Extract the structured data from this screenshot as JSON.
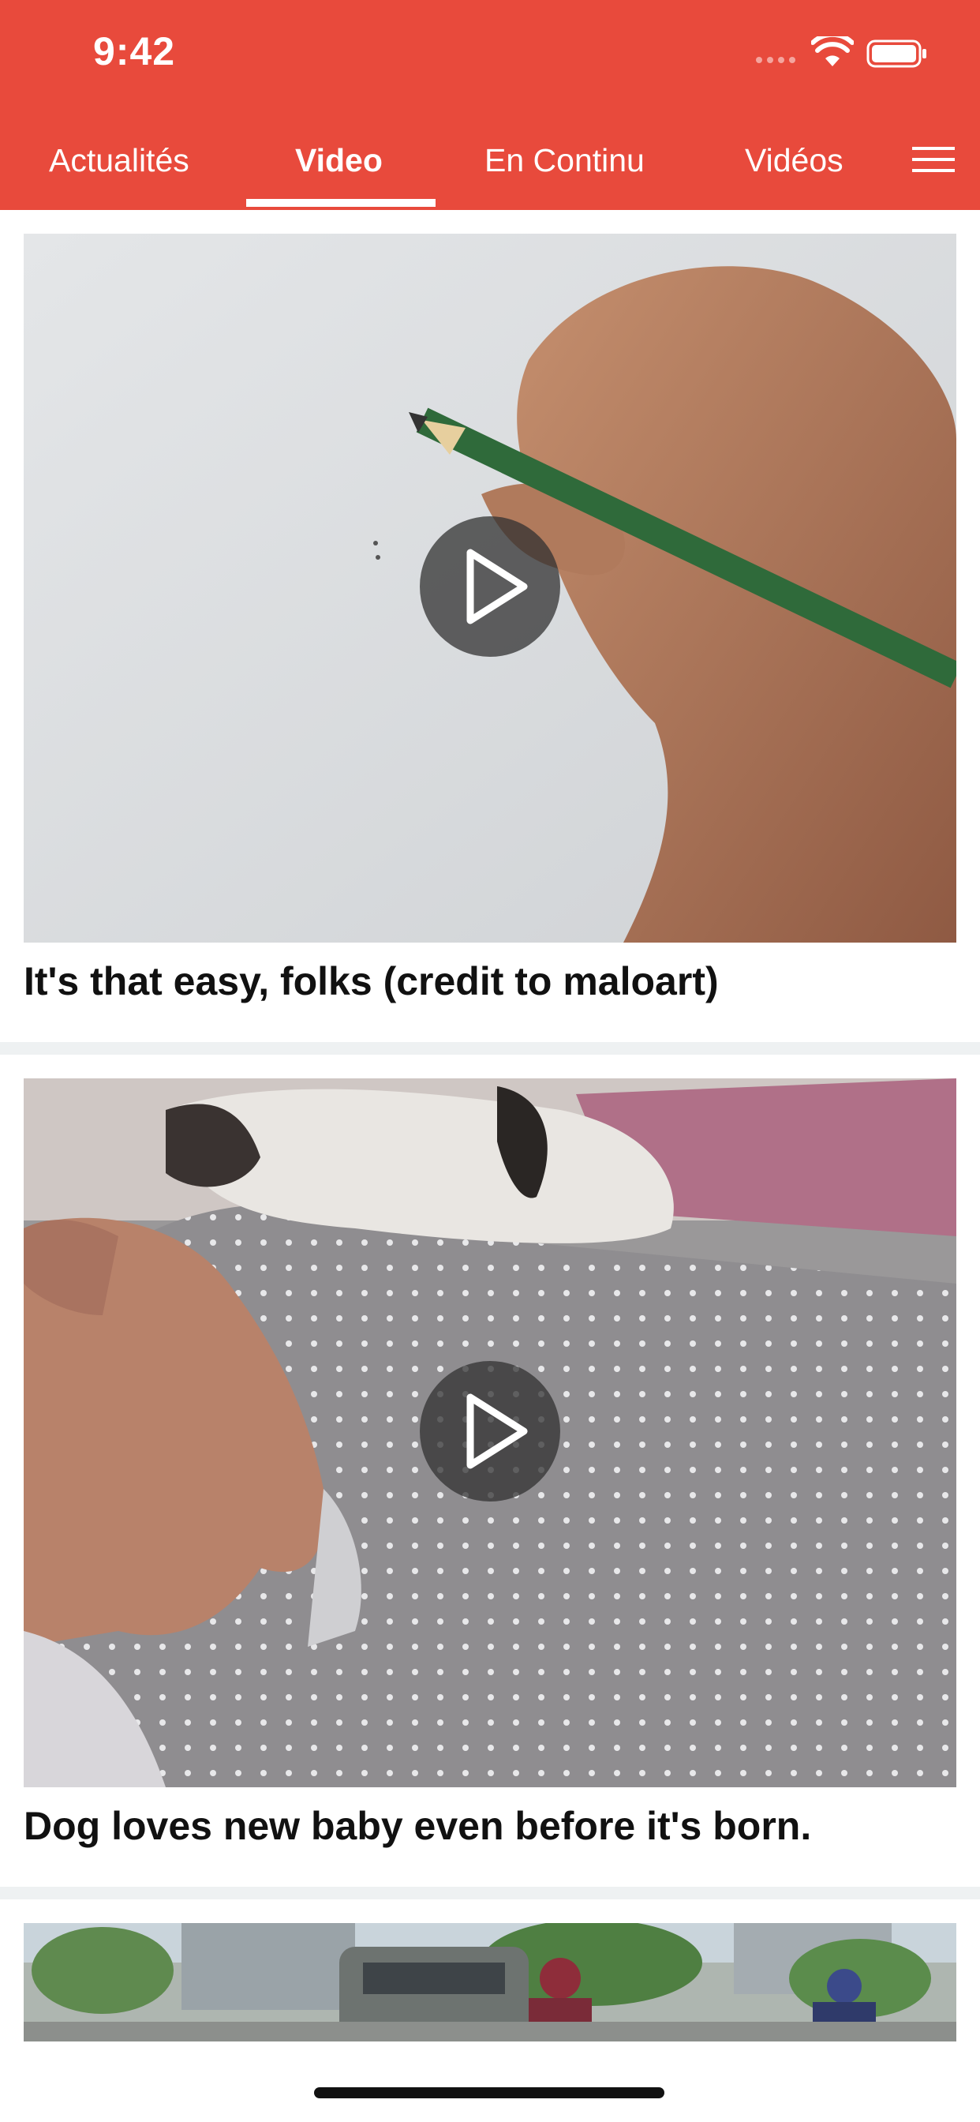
{
  "status_bar": {
    "time": "9:42"
  },
  "tabs": [
    {
      "label": "Actualités",
      "active": false
    },
    {
      "label": "Video",
      "active": true
    },
    {
      "label": "En Continu",
      "active": false
    },
    {
      "label": "Vidéos",
      "active": false
    }
  ],
  "feed": [
    {
      "title": "It's that easy, folks (credit to maloart)",
      "thumbnail": "hand drawing with green pencil"
    },
    {
      "title": "Dog loves new baby even before it's born.",
      "thumbnail": "dog resting on pregnant belly"
    },
    {
      "title": "",
      "thumbnail": "cyclists on a city street"
    }
  ],
  "colors": {
    "brand": "#e84a3c",
    "divider": "#eef1f2"
  },
  "icons": [
    "wifi-icon",
    "battery-icon",
    "menu-icon",
    "play-icon"
  ]
}
